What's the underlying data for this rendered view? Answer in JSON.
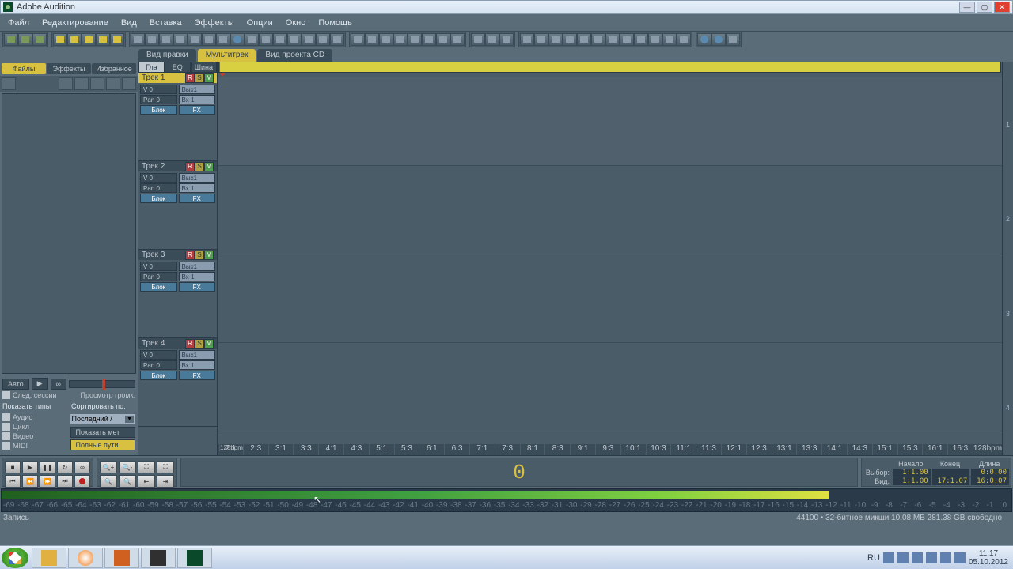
{
  "app": {
    "title": "Adobe Audition"
  },
  "menu": [
    "Файл",
    "Редактирование",
    "Вид",
    "Вставка",
    "Эффекты",
    "Опции",
    "Окно",
    "Помощь"
  ],
  "view_tabs": [
    {
      "label": "Вид правки",
      "active": false
    },
    {
      "label": "Мультитрек",
      "active": true
    },
    {
      "label": "Вид проекта CD",
      "active": false
    }
  ],
  "left_panel": {
    "tabs": [
      "Файлы",
      "Эффекты",
      "Избранное"
    ],
    "active_tab": 0,
    "footer": {
      "auto": "Авто",
      "follow_session": "След. сессии",
      "preview_vol": "Просмотр громк.",
      "show_types": "Показать типы",
      "sort_by": "Сортировать по:",
      "types": [
        "Аудио",
        "Цикл",
        "Видео",
        "MIDI"
      ],
      "sort_value": "Последний /",
      "show_marks": "Показать мет.",
      "full_paths": "Полные пути"
    }
  },
  "track_tabs": [
    "Гла",
    "EQ",
    "Шина"
  ],
  "tracks": [
    {
      "name": "Трек 1",
      "vol": "V 0",
      "pan": "Pan 0",
      "in": "Вх 1",
      "out": "Вых1",
      "block": "Блок",
      "fx": "FX",
      "selected": true
    },
    {
      "name": "Трек 2",
      "vol": "V 0",
      "pan": "Pan 0",
      "in": "Вх 1",
      "out": "Вых1",
      "block": "Блок",
      "fx": "FX",
      "selected": false
    },
    {
      "name": "Трек 3",
      "vol": "V 0",
      "pan": "Pan 0",
      "in": "Вх 1",
      "out": "Вых1",
      "block": "Блок",
      "fx": "FX",
      "selected": false
    },
    {
      "name": "Трек 4",
      "vol": "V 0",
      "pan": "Pan 0",
      "in": "Вх 1",
      "out": "Вых1",
      "block": "Блок",
      "fx": "FX",
      "selected": false
    }
  ],
  "timeline": {
    "bpm_left": "128bpm",
    "bpm_right": "128bpm",
    "bars": [
      "2:1",
      "2:3",
      "3:1",
      "3:3",
      "4:1",
      "4:3",
      "5:1",
      "5:3",
      "6:1",
      "6:3",
      "7:1",
      "7:3",
      "8:1",
      "8:3",
      "9:1",
      "9:3",
      "10:1",
      "10:3",
      "11:1",
      "11:3",
      "12:1",
      "12:3",
      "13:1",
      "13:3",
      "14:1",
      "14:3",
      "15:1",
      "15:3",
      "16:1",
      "16:3"
    ]
  },
  "big_time": "0",
  "selection": {
    "headers": [
      "Начало",
      "Конец",
      "Длина"
    ],
    "rows": [
      {
        "label": "Выбор:",
        "vals": [
          "1:1.00",
          "",
          "0:0.00"
        ]
      },
      {
        "label": "Вид:",
        "vals": [
          "1:1.00",
          "17:1.07",
          "16:0.07"
        ]
      }
    ]
  },
  "meter": {
    "ticks": [
      "-69",
      "-68",
      "-67",
      "-66",
      "-65",
      "-64",
      "-63",
      "-62",
      "-61",
      "-60",
      "-59",
      "-58",
      "-57",
      "-56",
      "-55",
      "-54",
      "-53",
      "-52",
      "-51",
      "-50",
      "-49",
      "-48",
      "-47",
      "-46",
      "-45",
      "-44",
      "-43",
      "-42",
      "-41",
      "-40",
      "-39",
      "-38",
      "-37",
      "-36",
      "-35",
      "-34",
      "-33",
      "-32",
      "-31",
      "-30",
      "-29",
      "-28",
      "-27",
      "-26",
      "-25",
      "-24",
      "-23",
      "-22",
      "-21",
      "-20",
      "-19",
      "-18",
      "-17",
      "-16",
      "-15",
      "-14",
      "-13",
      "-12",
      "-11",
      "-10",
      "-9",
      "-8",
      "-7",
      "-6",
      "-5",
      "-4",
      "-3",
      "-2",
      "-1",
      "0"
    ]
  },
  "status": {
    "left": "Запись",
    "right": "44100 • 32-битное микши   10.08 MB     281.38 GB свободно"
  },
  "taskbar": {
    "lang": "RU",
    "time": "11:17",
    "date": "05.10.2012"
  }
}
